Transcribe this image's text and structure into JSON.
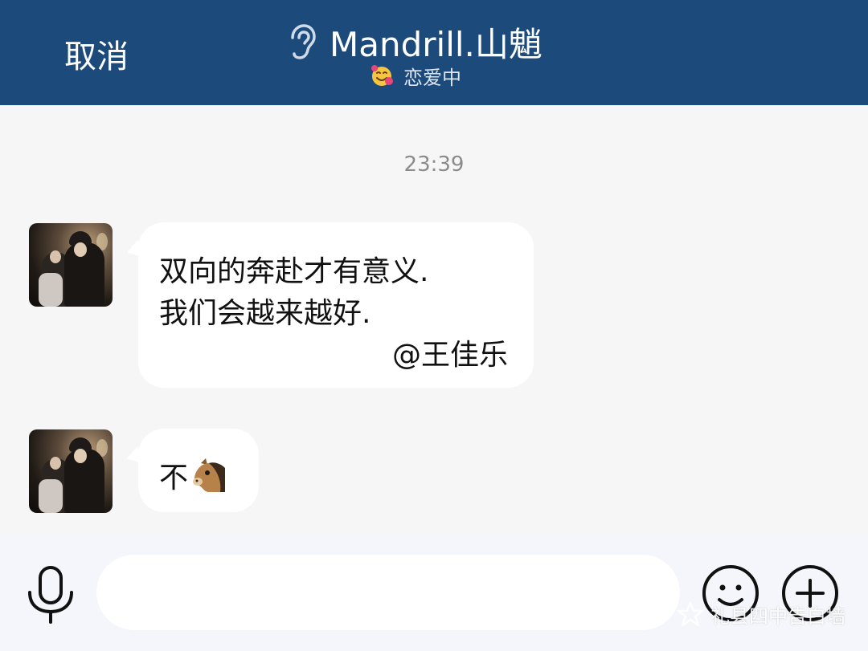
{
  "header": {
    "cancel_label": "取消",
    "title": "Mandrill.山魈",
    "status": "恋爱中",
    "bg_color": "#1b4a7b"
  },
  "chat": {
    "timestamp": "23:39",
    "messages": [
      {
        "lines": [
          "双向的奔赴才有意义.",
          "我们会越来越好.",
          "@王佳乐"
        ]
      },
      {
        "text": "不",
        "emoji": "horse-face"
      }
    ]
  },
  "input_bar": {
    "value": "",
    "placeholder": ""
  },
  "watermark": "礼县四中告白墙"
}
